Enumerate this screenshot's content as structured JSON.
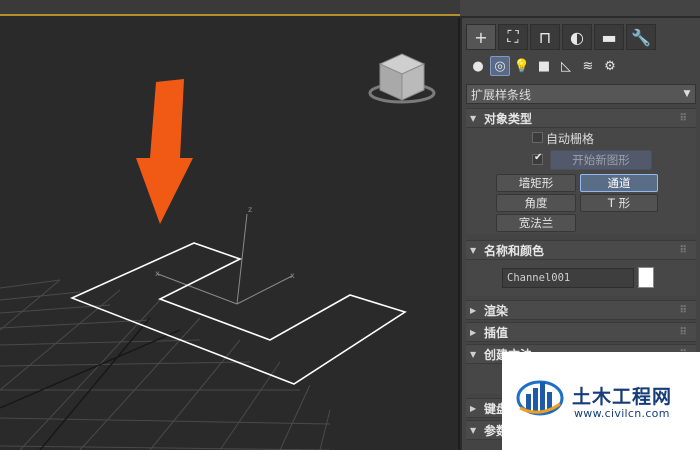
{
  "top_tabs": [
    {
      "icon": "create-plus-icon",
      "glyph": "+"
    },
    {
      "icon": "modify-icon",
      "glyph": "⛶"
    },
    {
      "icon": "hierarchy-icon",
      "glyph": "⊓"
    },
    {
      "icon": "motion-icon",
      "glyph": "◐"
    },
    {
      "icon": "display-icon",
      "glyph": "▬"
    },
    {
      "icon": "utilities-wrench-icon",
      "glyph": "🔧"
    }
  ],
  "object_category_icons": [
    {
      "icon": "geometry-sphere-icon",
      "glyph": "●"
    },
    {
      "icon": "shapes-icon",
      "glyph": "◎"
    },
    {
      "icon": "lights-icon",
      "glyph": "💡"
    },
    {
      "icon": "cameras-icon",
      "glyph": "■"
    },
    {
      "icon": "helpers-icon",
      "glyph": "◺"
    },
    {
      "icon": "spacewarps-icon",
      "glyph": "≋"
    },
    {
      "icon": "systems-icon",
      "glyph": "⚙"
    }
  ],
  "dropdown": {
    "value": "扩展样条线"
  },
  "object_type": {
    "header": "对象类型",
    "auto_grid_label": "自动栅格",
    "start_new_shape_label": "开始新图形",
    "buttons": [
      "墙矩形",
      "通道",
      "角度",
      "T 形",
      "宽法兰"
    ]
  },
  "name_and_color": {
    "header": "名称和颜色",
    "name_value": "Channel001",
    "swatch_color": "#ffffff"
  },
  "rollouts": [
    "渲染",
    "插值",
    "创建方法",
    "键盘输入",
    "参数"
  ],
  "watermark": {
    "title": "土木工程网",
    "url": "www.civilcn.com"
  },
  "accent_colors": {
    "arrow": "#f05a14",
    "selection_border": "#96b8f0",
    "viewport_border": "#b38f2c"
  }
}
